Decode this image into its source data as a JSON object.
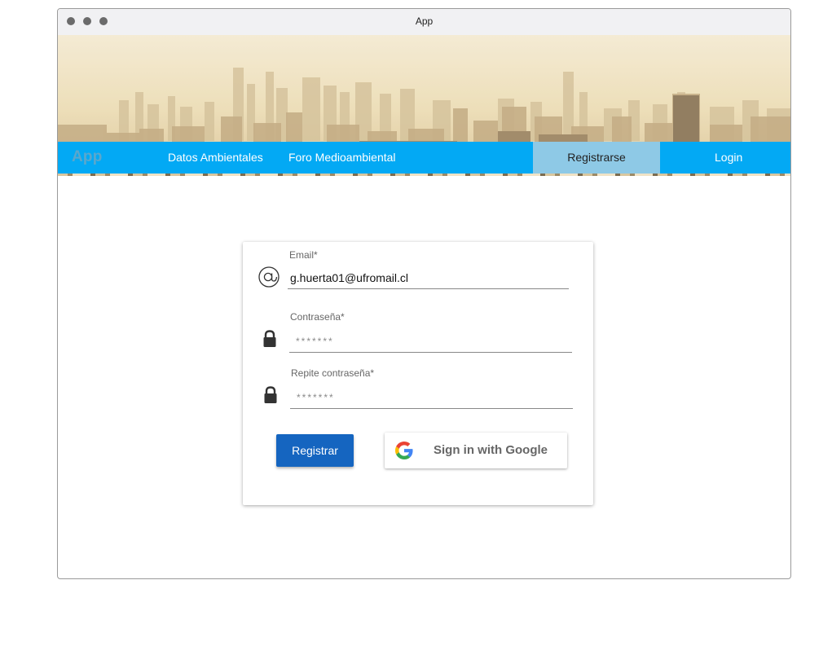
{
  "window": {
    "title": "App"
  },
  "navbar": {
    "brand": "App",
    "links": [
      "Datos Ambientales",
      "Foro Medioambiental"
    ],
    "register": "Registrarse",
    "login": "Login"
  },
  "form": {
    "email": {
      "label": "Email*",
      "value": "g.huerta01@ufromail.cl",
      "icon": "at-icon"
    },
    "password": {
      "label": "Contraseña*",
      "value": "*******",
      "icon": "lock-icon"
    },
    "password_repeat": {
      "label": "Repite contraseña*",
      "value": "*******",
      "icon": "lock-icon"
    },
    "submit_label": "Registrar",
    "google_label": "Sign in with Google"
  },
  "colors": {
    "navbar": "#03a9f4",
    "active_tab": "#8ec9e6",
    "primary_button": "#1565c0"
  }
}
